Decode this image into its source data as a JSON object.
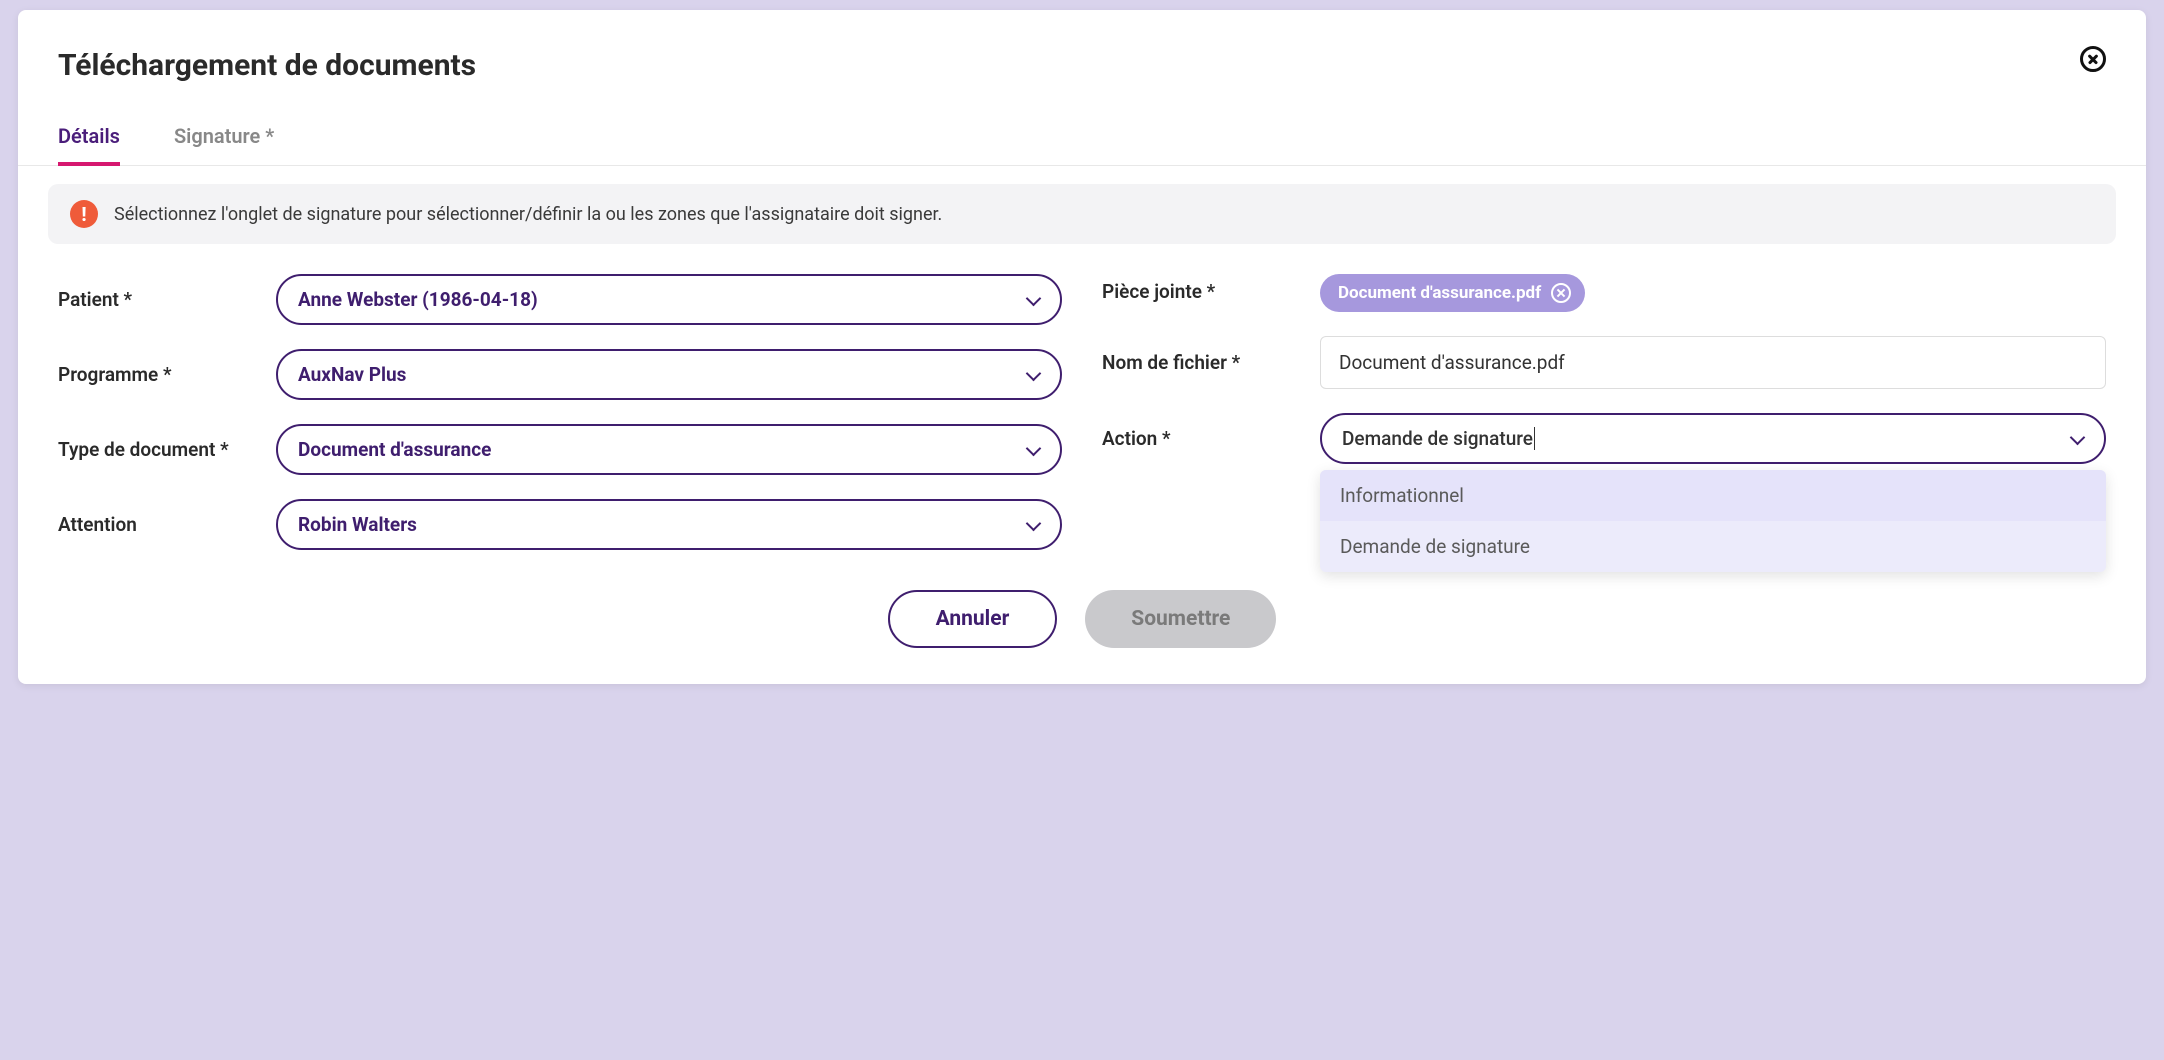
{
  "modal": {
    "title": "Téléchargement de documents"
  },
  "tabs": {
    "details": "Détails",
    "signature": "Signature *"
  },
  "alert": {
    "icon": "!",
    "text": "Sélectionnez l'onglet de signature pour sélectionner/définir la ou les zones que l'assignataire doit signer."
  },
  "form": {
    "patient": {
      "label": "Patient *",
      "value": "Anne Webster (1986-04-18)"
    },
    "programme": {
      "label": "Programme *",
      "value": "AuxNav Plus"
    },
    "doctype": {
      "label": "Type de document *",
      "value": "Document d'assurance"
    },
    "attention": {
      "label": "Attention",
      "value": "Robin Walters"
    },
    "attachment": {
      "label": "Pièce jointe *",
      "chip": "Document d'assurance.pdf"
    },
    "filename": {
      "label": "Nom de fichier *",
      "value": "Document d'assurance.pdf"
    },
    "action": {
      "label": "Action *",
      "value": "Demande de signature",
      "options": [
        "Informationnel",
        "Demande de signature"
      ]
    }
  },
  "buttons": {
    "cancel": "Annuler",
    "submit": "Soumettre"
  }
}
